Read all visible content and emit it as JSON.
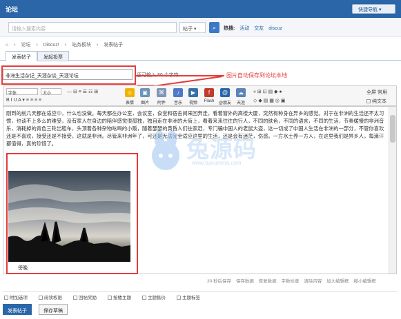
{
  "site": {
    "logo": "论坛",
    "quick_nav": "快捷导航 ▾"
  },
  "search": {
    "placeholder": "请输入搜索内容",
    "type": "帖子 ▾",
    "hot_label": "热搜:",
    "hot_items": [
      "活动",
      "交友",
      "discuz"
    ]
  },
  "breadcrumb": [
    "⌂",
    "›",
    "论坛",
    "›",
    "Discuz!",
    "›",
    "站务板块",
    "›",
    "发表帖子"
  ],
  "tabs": [
    "发表帖子",
    "发起投票"
  ],
  "post": {
    "title": "非洲生活杂记_天涯杂谈_天涯论坛",
    "hint": "还可输入 80 个字符",
    "note": "图片自动保存到论坛本地",
    "caption": "傍晚"
  },
  "toolbar": {
    "font": "字体",
    "size": "大小",
    "labels": [
      "表情",
      "图片",
      "附件",
      "音乐",
      "视频",
      "Flash",
      "@朋友",
      "天涯"
    ],
    "right_labels": [
      "全屏",
      "常用",
      "纯文本"
    ],
    "icons": [
      "smile-icon",
      "image-icon",
      "attach-icon",
      "music-icon",
      "video-icon",
      "flash-icon",
      "at-icon",
      "tianya-icon"
    ]
  },
  "body": "刚到的前几天都在适应中，什么也没做。每天都在办公室，会议室，食堂和宿舍间来回奔走，看着窗外的高楼大厦，突然有种身在异乡的感觉。对于在非洲的生活还不太习惯，也谈不上多么的难受，没有家人在身边的陪伴感觉很孤独，独自走在非洲的大街上，看着来来往往的行人，不同的肤色，不同的语言，不同的生活，节奏缓慢的非洲音乐，消耗掉的青色三轮出租车，头顶着各种杂物吆喝的小贩，随着瑟瑟的黄昏人们往家赶，专门骗中国人的老鼠大盗，这一切成了中国人生活在非洲的一部分，不管你喜欢还是不喜欢，接受还是不接受，这就是非洲。尽管来非洲年了，可还是无法完全适应这里的生活，还是会有迷茫，伤感。一方水土养一方人，在这里我们是异乡人，每滴汗都值得，真的珍惜了。",
  "watermark": {
    "text": "兔源码",
    "url": "www.tuyuanma.com"
  },
  "status": [
    "30 秒后保存",
    "保存数据",
    "恢复数据",
    "字数检查",
    "清除内容",
    "加大编辑框",
    "缩小编辑框"
  ],
  "options": [
    "附加选项",
    "阅读权限",
    "回帖奖励",
    "抢楼主题",
    "主题售价",
    "主题标签"
  ],
  "buttons": {
    "submit": "发表帖子",
    "draft": "保存草稿"
  },
  "colors": {
    "header": "#2a66a8",
    "highlight": "#e53b3b"
  }
}
